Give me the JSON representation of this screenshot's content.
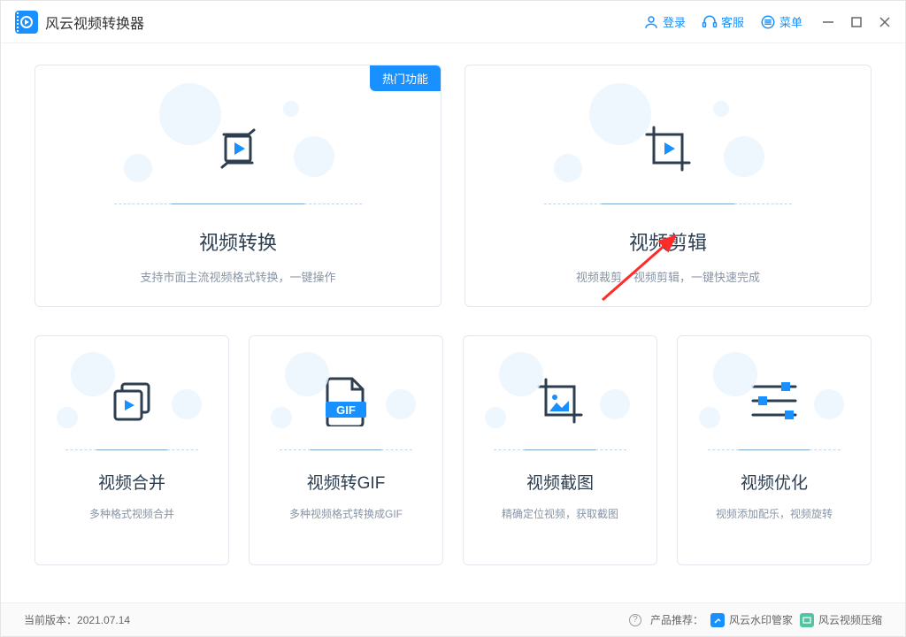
{
  "app": {
    "title": "风云视频转换器"
  },
  "titlebar": {
    "login": "登录",
    "service": "客服",
    "menu": "菜单"
  },
  "badge_hot": "热门功能",
  "cards_large": [
    {
      "title": "视频转换",
      "desc": "支持市面主流视频格式转换，一键操作",
      "icon": "convert"
    },
    {
      "title": "视频剪辑",
      "desc": "视频裁剪，视频剪辑，一键快速完成",
      "icon": "crop"
    }
  ],
  "cards_small": [
    {
      "title": "视频合并",
      "desc": "多种格式视频合并",
      "icon": "merge"
    },
    {
      "title": "视频转GIF",
      "desc": "多种视频格式转换成GIF",
      "icon": "gif"
    },
    {
      "title": "视频截图",
      "desc": "精确定位视频，获取截图",
      "icon": "screenshot"
    },
    {
      "title": "视频优化",
      "desc": "视频添加配乐，视频旋转",
      "icon": "sliders"
    }
  ],
  "footer": {
    "version_label": "当前版本：",
    "version": "2021.07.14",
    "recommend_label": "产品推荐：",
    "rec1": "风云水印管家",
    "rec2": "风云视频压缩"
  }
}
